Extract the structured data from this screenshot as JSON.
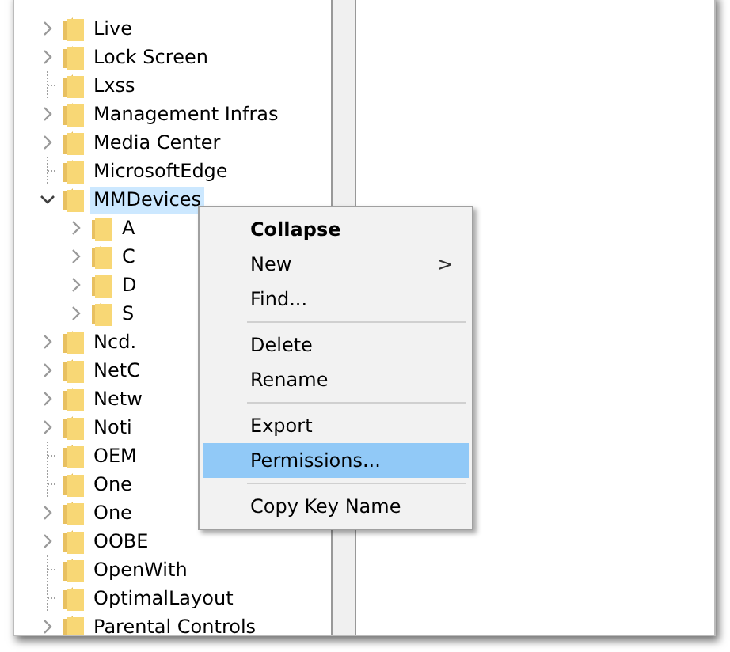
{
  "tree": [
    {
      "label": "Live",
      "kind": "collapsed",
      "selected": false
    },
    {
      "label": "Lock Screen",
      "kind": "collapsed",
      "selected": false
    },
    {
      "label": "Lxss",
      "kind": "leaf",
      "selected": false
    },
    {
      "label": "Management Infras",
      "kind": "collapsed",
      "selected": false
    },
    {
      "label": "Media Center",
      "kind": "collapsed",
      "selected": false
    },
    {
      "label": "MicrosoftEdge",
      "kind": "leaf",
      "selected": false
    },
    {
      "label": "MMDevices",
      "kind": "expanded",
      "selected": true,
      "children": [
        {
          "label": "A",
          "kind": "collapsed",
          "selected": false
        },
        {
          "label": "C",
          "kind": "collapsed",
          "selected": false
        },
        {
          "label": "D",
          "kind": "collapsed",
          "selected": false
        },
        {
          "label": "S",
          "kind": "collapsed",
          "selected": false
        }
      ]
    },
    {
      "label": "Ncd.",
      "kind": "collapsed",
      "selected": false
    },
    {
      "label": "NetC",
      "kind": "collapsed",
      "selected": false
    },
    {
      "label": "Netw",
      "kind": "collapsed",
      "selected": false
    },
    {
      "label": "Noti",
      "kind": "collapsed",
      "selected": false
    },
    {
      "label": "OEM",
      "kind": "leaf",
      "selected": false
    },
    {
      "label": "One",
      "kind": "leaf",
      "selected": false
    },
    {
      "label": "One",
      "kind": "collapsed",
      "selected": false
    },
    {
      "label": "OOBE",
      "kind": "collapsed",
      "selected": false
    },
    {
      "label": "OpenWith",
      "kind": "leaf",
      "selected": false
    },
    {
      "label": "OptimalLayout",
      "kind": "leaf",
      "selected": false
    },
    {
      "label": "Parental Controls",
      "kind": "collapsed",
      "selected": false
    }
  ],
  "context_menu": [
    {
      "kind": "item",
      "label": "Collapse",
      "bold": true,
      "selected": false
    },
    {
      "kind": "submenu",
      "label": "New",
      "arrow": ">",
      "selected": false
    },
    {
      "kind": "item",
      "label": "Find...",
      "selected": false
    },
    {
      "kind": "separator"
    },
    {
      "kind": "item",
      "label": "Delete",
      "selected": false
    },
    {
      "kind": "item",
      "label": "Rename",
      "selected": false
    },
    {
      "kind": "separator"
    },
    {
      "kind": "item",
      "label": "Export",
      "selected": false
    },
    {
      "kind": "item",
      "label": "Permissions...",
      "selected": true
    },
    {
      "kind": "separator"
    },
    {
      "kind": "item",
      "label": "Copy Key Name",
      "selected": false
    }
  ]
}
